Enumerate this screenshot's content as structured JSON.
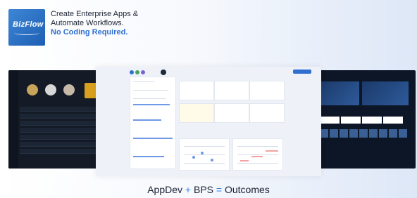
{
  "header": {
    "logo_alt": "BizFlow",
    "logo_text": "BizFlow",
    "line1": "Create Enterprise Apps &",
    "line2": "Automate Workflows.",
    "line3": "No Coding Required."
  },
  "footer": {
    "left": "AppDev",
    "plus": "+",
    "middle": "BPS",
    "equals": "=",
    "right": "Outcomes"
  },
  "colors": {
    "accent_blue": "#2f6fd0",
    "operator_blue": "#2f7fe0",
    "dark_panel": "#141b26",
    "gold_panel": "#d9a020"
  },
  "screenshots": [
    {
      "name": "dark-dashboard"
    },
    {
      "name": "task-dashboard"
    },
    {
      "name": "program-dashboard"
    }
  ]
}
